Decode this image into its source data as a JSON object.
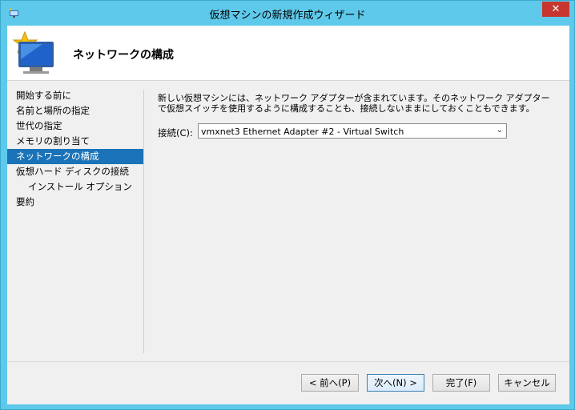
{
  "window": {
    "title": "仮想マシンの新規作成ウィザード",
    "close_glyph": "✕"
  },
  "header": {
    "title": "ネットワークの構成",
    "icon": "new-vm-wizard-icon"
  },
  "nav": {
    "items": [
      {
        "label": "開始する前に",
        "active": false,
        "sub": false
      },
      {
        "label": "名前と場所の指定",
        "active": false,
        "sub": false
      },
      {
        "label": "世代の指定",
        "active": false,
        "sub": false
      },
      {
        "label": "メモリの割り当て",
        "active": false,
        "sub": false
      },
      {
        "label": "ネットワークの構成",
        "active": true,
        "sub": false
      },
      {
        "label": "仮想ハード ディスクの接続",
        "active": false,
        "sub": false
      },
      {
        "label": "インストール オプション",
        "active": false,
        "sub": true
      },
      {
        "label": "要約",
        "active": false,
        "sub": false
      }
    ]
  },
  "content": {
    "description": "新しい仮想マシンには、ネットワーク アダプターが含まれています。そのネットワーク アダプターで仮想スイッチを使用するように構成することも、接続しないままにしておくこともできます。",
    "connection_label": "接続(C):",
    "connection_value": "vmxnet3 Ethernet Adapter #2 - Virtual Switch"
  },
  "buttons": {
    "back": "< 前へ(P)",
    "next": "次へ(N) >",
    "finish": "完了(F)",
    "cancel": "キャンセル"
  },
  "colors": {
    "frame": "#5ec9ea",
    "selection": "#1a73b8",
    "close": "#c7372f"
  }
}
